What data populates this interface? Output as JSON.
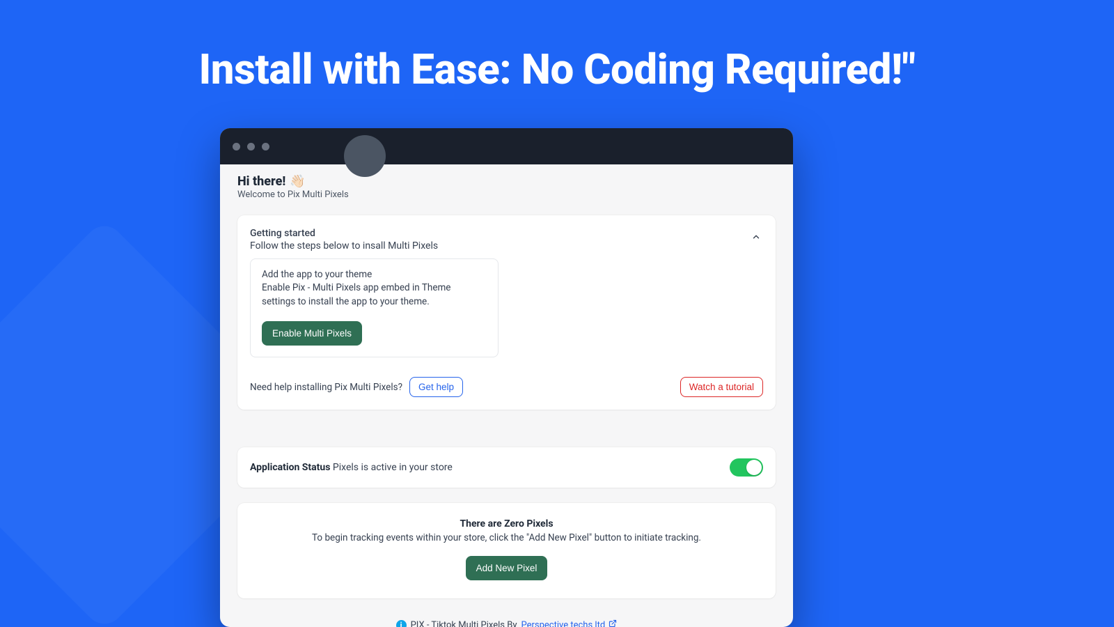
{
  "page": {
    "headline": "Install with Ease: No Coding Required!\""
  },
  "header": {
    "greeting": "Hi there!",
    "wave_emoji": "👋🏻",
    "subtitle": "Welcome to Pix Multi Pixels"
  },
  "getting_started": {
    "title": "Getting started",
    "subtitle": "Follow the steps below to insall Multi Pixels",
    "step": {
      "title": "Add the app to your theme",
      "description": "Enable Pix - Multi Pixels app embed in Theme settings to install the app to your theme.",
      "button_label": "Enable Multi Pixels"
    },
    "help_prompt": "Need help installing Pix Multi Pixels?",
    "get_help_label": "Get help",
    "watch_tutorial_label": "Watch a tutorial"
  },
  "status": {
    "label": "Application Status",
    "message": "Pixels is active in your store",
    "active": true
  },
  "zero_state": {
    "title": "There are Zero Pixels",
    "description": "To begin tracking events within your store, click the \"Add New Pixel\" button to initiate tracking.",
    "button_label": "Add New Pixel"
  },
  "footer": {
    "text": "PIX - Tiktok Multi Pixels By ",
    "link_label": "Perspective techs ltd"
  },
  "colors": {
    "brand_blue": "#1e65f6",
    "btn_green": "#2f6f54",
    "toggle_green": "#22c55e",
    "link_blue": "#2563eb",
    "danger_red": "#dc2626"
  }
}
